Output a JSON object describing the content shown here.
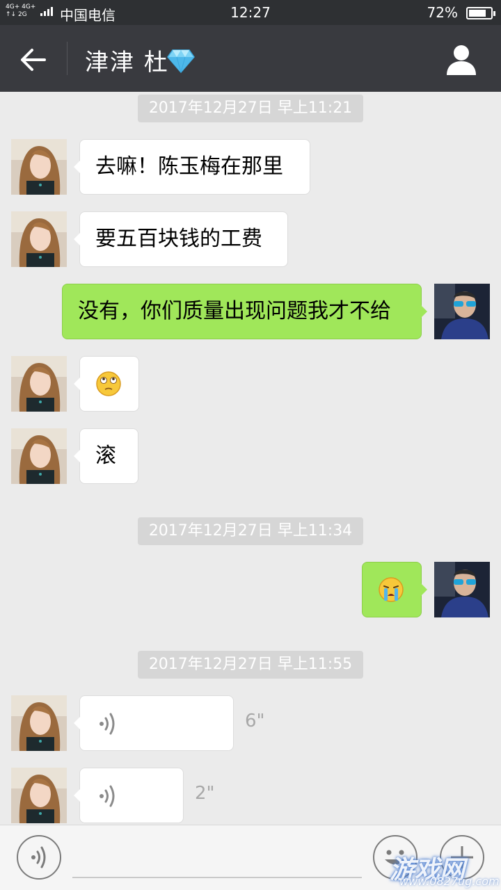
{
  "status_bar": {
    "network_top": "4G+ 4G+",
    "network_bottom": "↑↓ 2G",
    "carrier": "中国电信",
    "time": "12:27",
    "battery": "72%"
  },
  "header": {
    "title": "津津 杜",
    "title_badge_icon": "diamond-icon",
    "back_icon": "back-arrow-icon",
    "profile_icon": "person-icon"
  },
  "messages": [
    {
      "type": "timestamp",
      "text": "2017年12月27日 早上11:21"
    },
    {
      "type": "text",
      "side": "left",
      "text": "去嘛！陈玉梅在那里"
    },
    {
      "type": "text",
      "side": "left",
      "text": "要五百块钱的工费"
    },
    {
      "type": "text",
      "side": "right",
      "text": "没有，你们质量出现问题我才不给"
    },
    {
      "type": "emoji",
      "side": "left",
      "icon": "eye-roll-emoji-icon"
    },
    {
      "type": "text",
      "side": "left",
      "text": "滚"
    },
    {
      "type": "timestamp",
      "text": "2017年12月27日 早上11:34"
    },
    {
      "type": "emoji",
      "side": "right",
      "icon": "crying-emoji-icon"
    },
    {
      "type": "timestamp",
      "text": "2017年12月27日 早上11:55"
    },
    {
      "type": "voice",
      "side": "left",
      "duration": "6\""
    },
    {
      "type": "voice",
      "side": "left",
      "duration": "2\""
    }
  ],
  "input_bar": {
    "voice_icon": "voice-mode-icon",
    "emoji_icon": "smiley-icon",
    "more_icon": "plus-icon",
    "placeholder": ""
  },
  "watermark": {
    "text": "游戏网",
    "url": "www.0827ug.com"
  },
  "colors": {
    "header_bg": "#393a3f",
    "chat_bg": "#ebebeb",
    "sent_bubble": "#a0e75a",
    "received_bubble": "#ffffff",
    "timestamp_bg": "#d6d6d6"
  }
}
